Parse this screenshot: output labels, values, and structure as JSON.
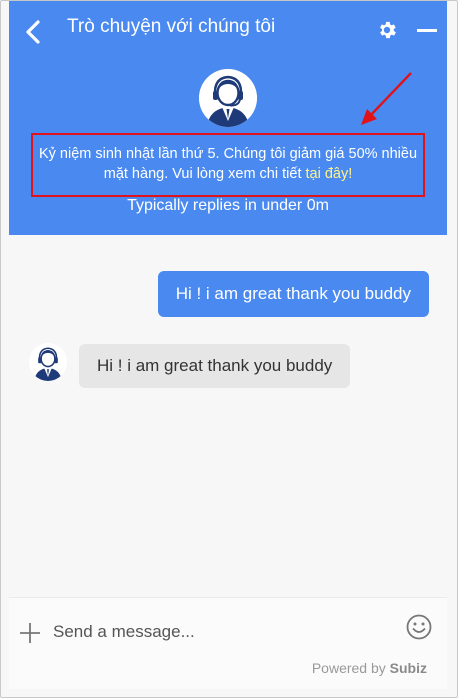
{
  "header": {
    "title": "Trò chuyện với chúng tôi",
    "back_icon": "chevron-left-icon",
    "settings_icon": "gear-icon",
    "minimize_icon": "minus-icon",
    "promo_text": "Kỷ niệm sinh nhật lần thứ 5. Chúng tôi giảm giá 50% nhiều mặt hàng. Vui lòng xem chi tiết ",
    "promo_link": "tại đây!",
    "replies": "Typically replies in under 0m"
  },
  "messages": [
    {
      "direction": "outgoing",
      "text": "Hi ! i am great thank you buddy"
    },
    {
      "direction": "incoming",
      "text": "Hi ! i am great thank you buddy"
    }
  ],
  "composer": {
    "placeholder": "Send a message...",
    "value": "",
    "attach_icon": "plus-icon",
    "emoji_icon": "smiley-icon",
    "powered_by": "Powered by",
    "brand": "Subiz"
  },
  "colors": {
    "accent": "#4a8af0",
    "annotation": "#e0121a",
    "link": "#fff48a",
    "incoming_bubble": "#e6e6e6"
  }
}
